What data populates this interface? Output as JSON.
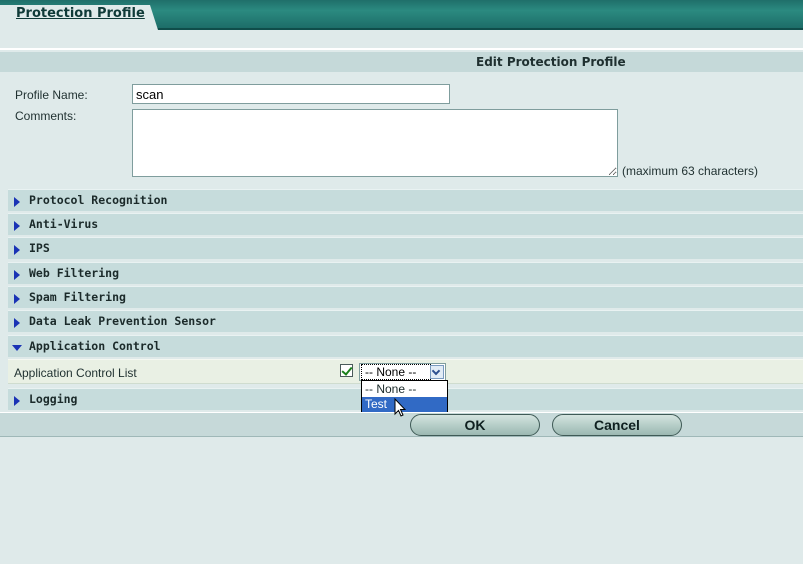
{
  "tab": {
    "label": "Protection Profile"
  },
  "form": {
    "header": "Edit Protection Profile",
    "profile_name_label": "Profile Name:",
    "profile_name_value": "scan",
    "comments_label": "Comments:",
    "comments_value": "",
    "max_note": "(maximum 63 characters)"
  },
  "sections": [
    {
      "title": "Protocol Recognition",
      "expanded": false
    },
    {
      "title": "Anti-Virus",
      "expanded": false
    },
    {
      "title": "IPS",
      "expanded": false
    },
    {
      "title": "Web Filtering",
      "expanded": false
    },
    {
      "title": "Spam Filtering",
      "expanded": false
    },
    {
      "title": "Data Leak Prevention Sensor",
      "expanded": false
    },
    {
      "title": "Application Control",
      "expanded": true
    },
    {
      "title": "Logging",
      "expanded": false
    }
  ],
  "app_control": {
    "list_label": "Application Control List",
    "enabled": true,
    "selected": "-- None --",
    "options": [
      "-- None --",
      "Test"
    ],
    "highlighted_option": "Test"
  },
  "buttons": {
    "ok": "OK",
    "cancel": "Cancel"
  },
  "colors": {
    "topbar": "#1f6f6a",
    "section_bg": "#c6dcdc",
    "expand_arrow": "#1a33b5",
    "selection": "#316ac5"
  },
  "icons": {
    "collapsed": "triangle-right-icon",
    "expanded": "triangle-down-icon",
    "check": "checkmark-icon",
    "dropdown": "chevron-down-icon",
    "cursor": "mouse-pointer-icon"
  }
}
